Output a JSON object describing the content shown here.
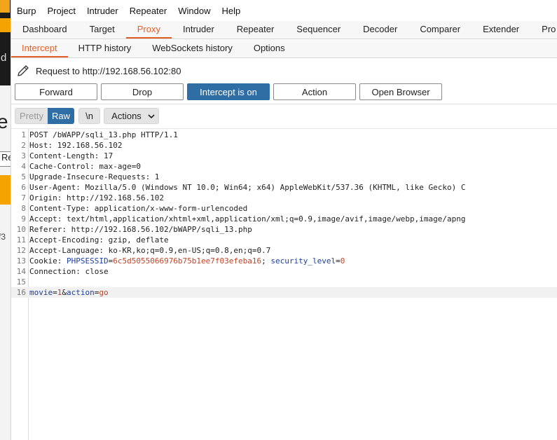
{
  "background_window": {
    "fragments": [
      "d",
      "e",
      "Re",
      "f3"
    ]
  },
  "menubar": {
    "items": [
      "Burp",
      "Project",
      "Intruder",
      "Repeater",
      "Window",
      "Help"
    ]
  },
  "main_tabs": {
    "items": [
      "Dashboard",
      "Target",
      "Proxy",
      "Intruder",
      "Repeater",
      "Sequencer",
      "Decoder",
      "Comparer",
      "Extender",
      "Pro"
    ],
    "active": "Proxy"
  },
  "sub_tabs": {
    "items": [
      "Intercept",
      "HTTP history",
      "WebSockets history",
      "Options"
    ],
    "active": "Intercept"
  },
  "request": {
    "label": "Request to http://192.168.56.102:80",
    "icon": "pencil-icon"
  },
  "actions": {
    "forward": "Forward",
    "drop": "Drop",
    "intercept": "Intercept is on",
    "action": "Action",
    "open_browser": "Open Browser"
  },
  "editor_toolbar": {
    "pretty": "Pretty",
    "raw": "Raw",
    "newline": "\\n",
    "actions": "Actions"
  },
  "request_lines": [
    {
      "n": "1",
      "text": "POST /bWAPP/sqli_13.php HTTP/1.1"
    },
    {
      "n": "2",
      "text": "Host: 192.168.56.102"
    },
    {
      "n": "3",
      "text": "Content-Length: 17"
    },
    {
      "n": "4",
      "text": "Cache-Control: max-age=0"
    },
    {
      "n": "5",
      "text": "Upgrade-Insecure-Requests: 1"
    },
    {
      "n": "6",
      "text": "User-Agent: Mozilla/5.0 (Windows NT 10.0; Win64; x64) AppleWebKit/537.36 (KHTML, like Gecko) C"
    },
    {
      "n": "7",
      "text": "Origin: http://192.168.56.102"
    },
    {
      "n": "8",
      "text": "Content-Type: application/x-www-form-urlencoded"
    },
    {
      "n": "9",
      "text": "Accept: text/html,application/xhtml+xml,application/xml;q=0.9,image/avif,image/webp,image/apng"
    },
    {
      "n": "10",
      "text": "Referer: http://192.168.56.102/bWAPP/sqli_13.php"
    },
    {
      "n": "11",
      "text": "Accept-Encoding: gzip, deflate"
    },
    {
      "n": "12",
      "text": "Accept-Language: ko-KR,ko;q=0.9,en-US;q=0.8,en;q=0.7"
    },
    {
      "n": "13",
      "cookie": {
        "prefix": "Cookie: ",
        "name1": "PHPSESSID",
        "val1": "6c5d5055066976b75b1ee7f03efeba16",
        "sep": "; ",
        "name2": "security_level",
        "val2": "0"
      }
    },
    {
      "n": "14",
      "text": "Connection: close"
    },
    {
      "n": "15",
      "text": ""
    },
    {
      "n": "16",
      "body": {
        "k1": "movie",
        "v1": "1",
        "k2": "action",
        "v2": "go"
      }
    }
  ],
  "colors": {
    "accent": "#e0602a",
    "primary_button": "#2f6ea5",
    "param_name": "#1c3fa0",
    "param_value": "#c0442a"
  }
}
